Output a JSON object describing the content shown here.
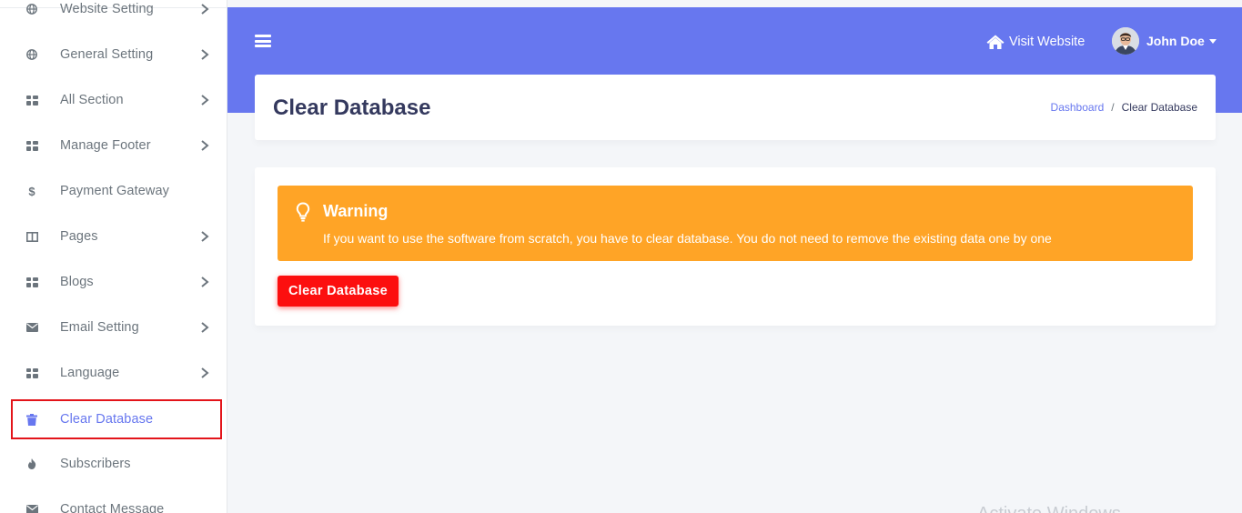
{
  "sidebar": {
    "items": [
      {
        "label": "Website Setting",
        "icon": "globe-icon",
        "has_arrow": true
      },
      {
        "label": "General Setting",
        "icon": "globe-icon",
        "has_arrow": true
      },
      {
        "label": "All Section",
        "icon": "th-large-icon",
        "has_arrow": true
      },
      {
        "label": "Manage Footer",
        "icon": "th-large-icon",
        "has_arrow": true
      },
      {
        "label": "Payment Gateway",
        "icon": "dollar-icon",
        "has_arrow": false
      },
      {
        "label": "Pages",
        "icon": "columns-icon",
        "has_arrow": true
      },
      {
        "label": "Blogs",
        "icon": "th-large-icon",
        "has_arrow": true
      },
      {
        "label": "Email Setting",
        "icon": "envelope-icon",
        "has_arrow": true
      },
      {
        "label": "Language",
        "icon": "th-large-icon",
        "has_arrow": true
      },
      {
        "label": "Clear Database",
        "icon": "trash-icon",
        "has_arrow": false,
        "active": true
      },
      {
        "label": "Subscribers",
        "icon": "fire-icon",
        "has_arrow": false
      },
      {
        "label": "Contact Message",
        "icon": "envelope-icon",
        "has_arrow": false
      }
    ]
  },
  "navbar": {
    "visit_label": "Visit Website",
    "user_name": "John Doe"
  },
  "header": {
    "title": "Clear Database",
    "breadcrumb": {
      "home": "Dashboard",
      "current": "Clear Database",
      "separator": "/"
    }
  },
  "alert": {
    "title": "Warning",
    "message": "If you want to use the software from scratch, you have to clear database. You do not need to remove the existing data one by one"
  },
  "actions": {
    "clear_label": "Clear Database"
  },
  "watermark": "Activate Windows",
  "colors": {
    "primary": "#6777ef",
    "warning": "#ffa426",
    "danger": "#fc0f0f",
    "highlight_border": "#e3141a"
  }
}
